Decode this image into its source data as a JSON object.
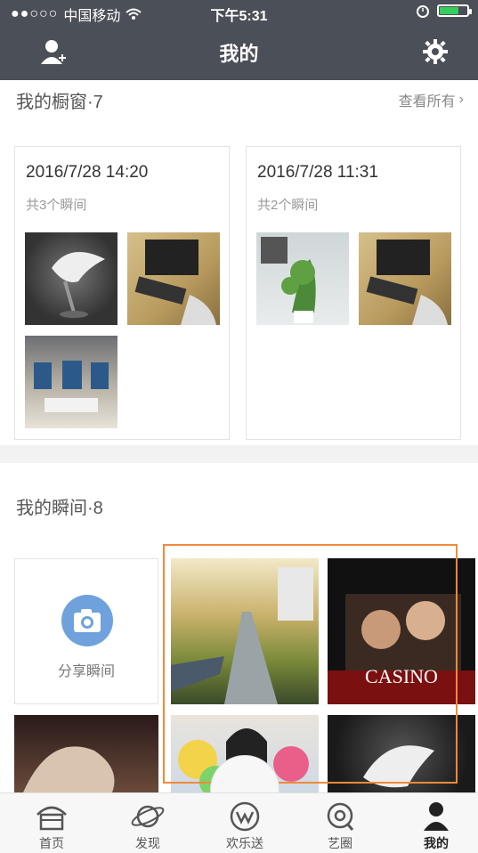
{
  "status_bar": {
    "carrier": "中国移动",
    "time": "下午5:31",
    "battery_level": 0.7
  },
  "header": {
    "title": "我的"
  },
  "showcase": {
    "title": "我的橱窗·7",
    "see_all": "查看所有",
    "cards": [
      {
        "date": "2016/7/28 14:20",
        "count": "共3个瞬间"
      },
      {
        "date": "2016/7/28 11:31",
        "count": "共2个瞬间"
      }
    ]
  },
  "moments": {
    "title": "我的瞬间·8",
    "share_label": "分享瞬间"
  },
  "tabs": [
    {
      "label": "首页",
      "icon": "home-icon"
    },
    {
      "label": "发现",
      "icon": "planet-icon"
    },
    {
      "label": "欢乐送",
      "icon": "w-logo-icon"
    },
    {
      "label": "艺圈",
      "icon": "circle-at-icon"
    },
    {
      "label": "我的",
      "icon": "user-icon"
    }
  ],
  "colors": {
    "header_bg": "#4b4f57",
    "accent_blue": "#6fa2dc",
    "highlight_orange": "#f08a3c"
  }
}
